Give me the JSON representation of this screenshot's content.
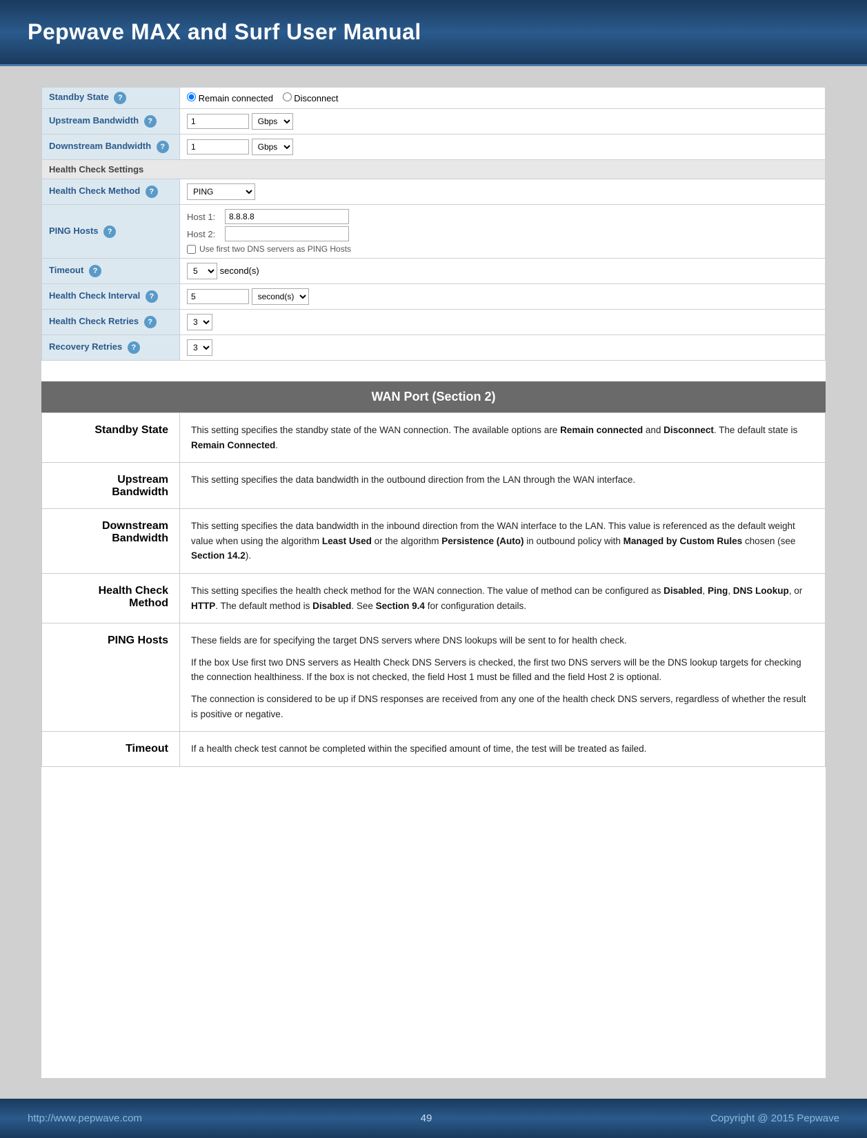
{
  "header": {
    "title": "Pepwave MAX and Surf User Manual"
  },
  "settings_form": {
    "rows": [
      {
        "label": "Standby State",
        "type": "radio",
        "options": [
          "Remain connected",
          "Disconnect"
        ],
        "selected": "Remain connected"
      },
      {
        "label": "Upstream Bandwidth",
        "type": "bandwidth",
        "value": "1",
        "unit": "Gbps"
      },
      {
        "label": "Downstream Bandwidth",
        "type": "bandwidth",
        "value": "1",
        "unit": "Gbps"
      },
      {
        "label": "Health Check Settings",
        "type": "section_header"
      },
      {
        "label": "Health Check Method",
        "type": "select",
        "options": [
          "PING"
        ],
        "selected": "PING"
      },
      {
        "label": "PING Hosts",
        "type": "ping_hosts",
        "host1": "8.8.8.8",
        "host2": "",
        "checkbox_label": "Use first two DNS servers as PING Hosts"
      },
      {
        "label": "Timeout",
        "type": "timeout",
        "value": "5",
        "unit": "second(s)"
      },
      {
        "label": "Health Check Interval",
        "type": "interval",
        "value": "5",
        "unit": "second(s)"
      },
      {
        "label": "Health Check Retries",
        "type": "small_select",
        "value": "3"
      },
      {
        "label": "Recovery Retries",
        "type": "small_select",
        "value": "3"
      }
    ]
  },
  "wan_section": {
    "title": "WAN Port (Section 2)",
    "terms": [
      {
        "term": "Standby State",
        "description": "This setting specifies the standby state of the WAN connection. The available options are <b>Remain connected</b> and <b>Disconnect</b>. The default state is <b>Remain Connected</b>."
      },
      {
        "term": "Upstream\nBandwidth",
        "description": "This setting specifies the data bandwidth in the outbound direction from the LAN through the WAN interface."
      },
      {
        "term": "Downstream\nBandwidth",
        "description": "This setting specifies the data bandwidth in the inbound direction from the WAN interface to the LAN. This value is referenced as the default weight value when using the algorithm <b>Least Used</b> or the algorithm <b>Persistence (Auto)</b> in outbound policy with <b>Managed by Custom Rules</b> chosen (see <b>Section 14.2</b>)."
      },
      {
        "term": "Health Check\nMethod",
        "description": "This setting specifies the health check method for the WAN connection. The value of method can be configured as <b>Disabled</b>, <b>Ping</b>, <b>DNS Lookup</b>, or <b>HTTP</b>. The default method is <b>Disabled</b>. See <b>Section 9.4</b> for configuration details."
      },
      {
        "term": "PING Hosts",
        "description_parts": [
          "These fields are for specifying the target DNS servers where DNS lookups will be sent to for health check.",
          "If the box Use first two DNS servers as Health Check DNS Servers is checked, the first two DNS servers will be the DNS lookup targets for checking the connection healthiness. If the box is not checked, the field Host 1 must be filled and the field Host 2 is optional.",
          "The connection is considered to be up if DNS responses are received from any one of the health check DNS servers, regardless of whether the result is positive or negative."
        ]
      },
      {
        "term": "Timeout",
        "description": "If a health check test cannot be completed within the specified amount of time, the test will be treated as failed."
      }
    ]
  },
  "footer": {
    "url": "http://www.pepwave.com",
    "page": "49",
    "copyright": "Copyright @ 2015 Pepwave"
  }
}
